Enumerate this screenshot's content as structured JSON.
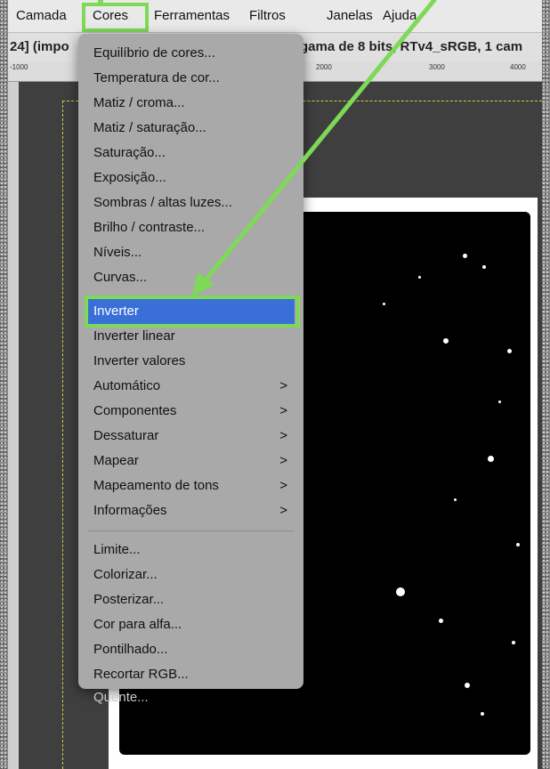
{
  "menubar": {
    "items": [
      "Camada",
      "Cores",
      "Ferramentas",
      "Filtros",
      "Janelas",
      "Ajuda"
    ]
  },
  "titlebar": {
    "left_text": "24] (impo",
    "right_text": "gama de 8 bits, RTv4_sRGB, 1 cam"
  },
  "ruler": {
    "ticks": [
      "-1000",
      "2000",
      "3000",
      "4000"
    ]
  },
  "menu": {
    "group1": [
      "Equilíbrio de cores...",
      "Temperatura de cor...",
      "Matiz / croma...",
      "Matiz / saturação...",
      "Saturação...",
      "Exposição...",
      "Sombras / altas luzes...",
      "Brilho / contraste...",
      "Níveis...",
      "Curvas..."
    ],
    "group2": [
      "Inverter",
      "Inverter linear",
      "Inverter valores",
      "Automático",
      "Componentes",
      "Dessaturar",
      "Mapear",
      "Mapeamento de tons",
      "Informações"
    ],
    "group3": [
      "Limite...",
      "Colorizar...",
      "Posterizar...",
      "Cor para alfa...",
      "Pontilhado...",
      "Recortar RGB...",
      "Quente..."
    ],
    "selected": "Inverter",
    "submenu_chevron": ">",
    "disabled_item": "Quente..."
  },
  "colors": {
    "highlight_green": "#7ed957",
    "selection_blue": "#3a6fd8",
    "menu_bg": "#a9a9a9"
  }
}
